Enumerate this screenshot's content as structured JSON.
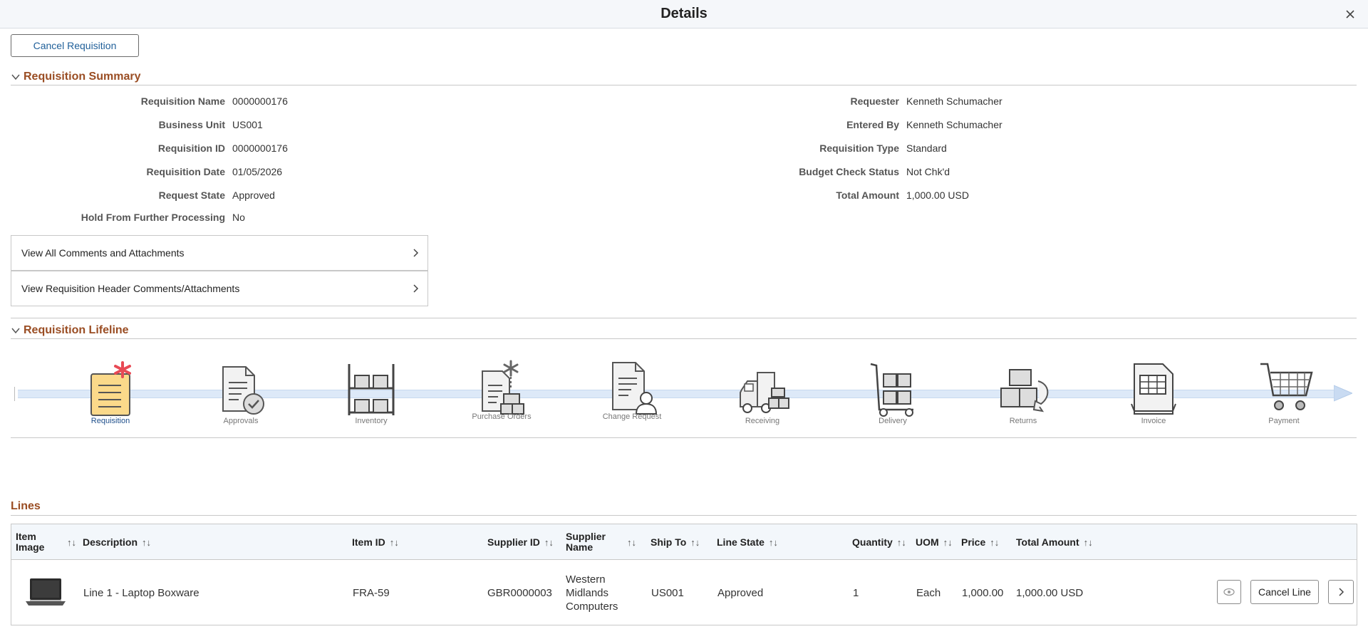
{
  "window": {
    "title": "Details",
    "close_icon": "close-icon"
  },
  "actions": {
    "cancel_requisition": "Cancel Requisition"
  },
  "summary": {
    "heading": "Requisition Summary",
    "left": [
      {
        "label": "Requisition Name",
        "value": "0000000176"
      },
      {
        "label": "Business Unit",
        "value": "US001"
      },
      {
        "label": "Requisition ID",
        "value": "0000000176"
      },
      {
        "label": "Requisition Date",
        "value": "01/05/2026"
      },
      {
        "label": "Request State",
        "value": "Approved"
      },
      {
        "label": "Hold From Further Processing",
        "value": "No"
      }
    ],
    "right": [
      {
        "label": "Requester",
        "value": "Kenneth Schumacher"
      },
      {
        "label": "Entered By",
        "value": "Kenneth Schumacher"
      },
      {
        "label": "Requisition Type",
        "value": "Standard"
      },
      {
        "label": "Budget Check Status",
        "value": "Not Chk'd"
      },
      {
        "label": "Total Amount",
        "value": "1,000.00 USD"
      }
    ],
    "links": [
      {
        "label": "View All Comments and Attachments"
      },
      {
        "label": "View Requisition Header Comments/Attachments"
      }
    ]
  },
  "lifeline": {
    "heading": "Requisition Lifeline",
    "stages": [
      {
        "label": "Requisition",
        "icon": "requisition-icon",
        "active": true
      },
      {
        "label": "Approvals",
        "icon": "approvals-icon"
      },
      {
        "label": "Inventory",
        "icon": "inventory-icon"
      },
      {
        "label": "Purchase Orders",
        "icon": "purchase-orders-icon"
      },
      {
        "label": "Change Request",
        "icon": "change-request-icon"
      },
      {
        "label": "Receiving",
        "icon": "receiving-icon"
      },
      {
        "label": "Delivery",
        "icon": "delivery-icon"
      },
      {
        "label": "Returns",
        "icon": "returns-icon"
      },
      {
        "label": "Invoice",
        "icon": "invoice-icon"
      },
      {
        "label": "Payment",
        "icon": "payment-icon"
      }
    ]
  },
  "lines": {
    "heading": "Lines",
    "sort_icon": "↑↓",
    "columns": {
      "item_image": "Item Image",
      "description": "Description",
      "item_id": "Item ID",
      "supplier_id": "Supplier ID",
      "supplier_name": "Supplier Name",
      "ship_to": "Ship To",
      "line_state": "Line State",
      "quantity": "Quantity",
      "uom": "UOM",
      "price": "Price",
      "total_amount": "Total Amount"
    },
    "rows": [
      {
        "image_icon": "laptop-icon",
        "description": "Line 1 - Laptop Boxware",
        "item_id": "FRA-59",
        "supplier_id": "GBR0000003",
        "supplier_name": "Western Midlands Computers",
        "ship_to": "US001",
        "line_state": "Approved",
        "quantity": "1",
        "uom": "Each",
        "price": "1,000.00",
        "total_amount": "1,000.00 USD",
        "cancel_line": "Cancel Line"
      }
    ]
  },
  "colors": {
    "section_heading": "#9a4d23",
    "link_blue": "#1f5f99",
    "track": "#dde9f8"
  }
}
